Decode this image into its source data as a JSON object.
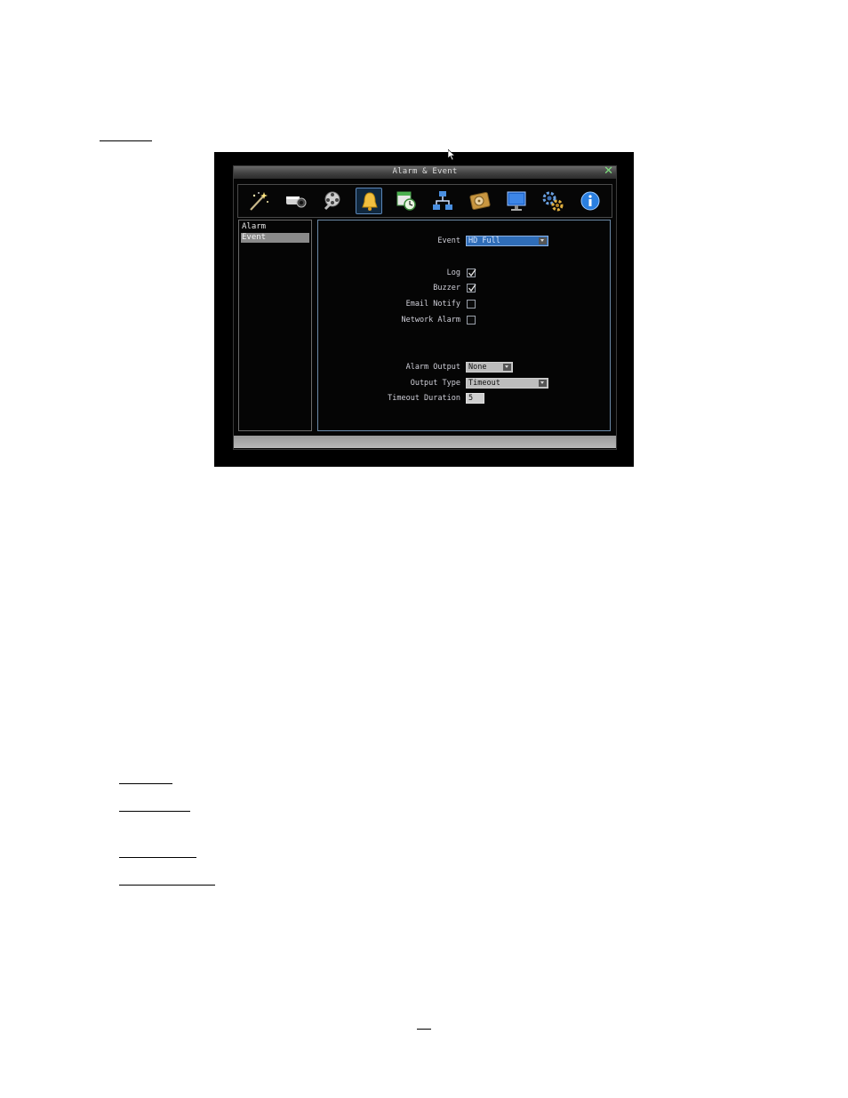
{
  "window": {
    "title": "Alarm & Event",
    "close_glyph": "✕"
  },
  "toolbar": {
    "icons": [
      {
        "name": "wizard-wand-icon"
      },
      {
        "name": "camera-icon"
      },
      {
        "name": "record-search-icon"
      },
      {
        "name": "alarm-bell-icon",
        "selected": true
      },
      {
        "name": "schedule-clock-icon"
      },
      {
        "name": "network-icon"
      },
      {
        "name": "hard-disk-icon"
      },
      {
        "name": "display-monitor-icon"
      },
      {
        "name": "system-gears-icon"
      },
      {
        "name": "info-icon"
      }
    ]
  },
  "sidebar": {
    "items": [
      {
        "label": "Alarm",
        "selected": false
      },
      {
        "label": "Event",
        "selected": true
      }
    ]
  },
  "form": {
    "event_label": "Event",
    "event_value": "HD Full",
    "log_label": "Log",
    "log_checked": true,
    "buzzer_label": "Buzzer",
    "buzzer_checked": true,
    "email_label": "Email Notify",
    "email_checked": false,
    "network_label": "Network Alarm",
    "network_checked": false,
    "alarm_output_label": "Alarm Output",
    "alarm_output_value": "None",
    "output_type_label": "Output Type",
    "output_type_value": "Timeout",
    "timeout_label": "Timeout Duration",
    "timeout_value": "5"
  },
  "colors": {
    "accent_blue": "#2f6db8",
    "close_green": "#7fe07f",
    "frame_border": "#6c8aa8"
  }
}
